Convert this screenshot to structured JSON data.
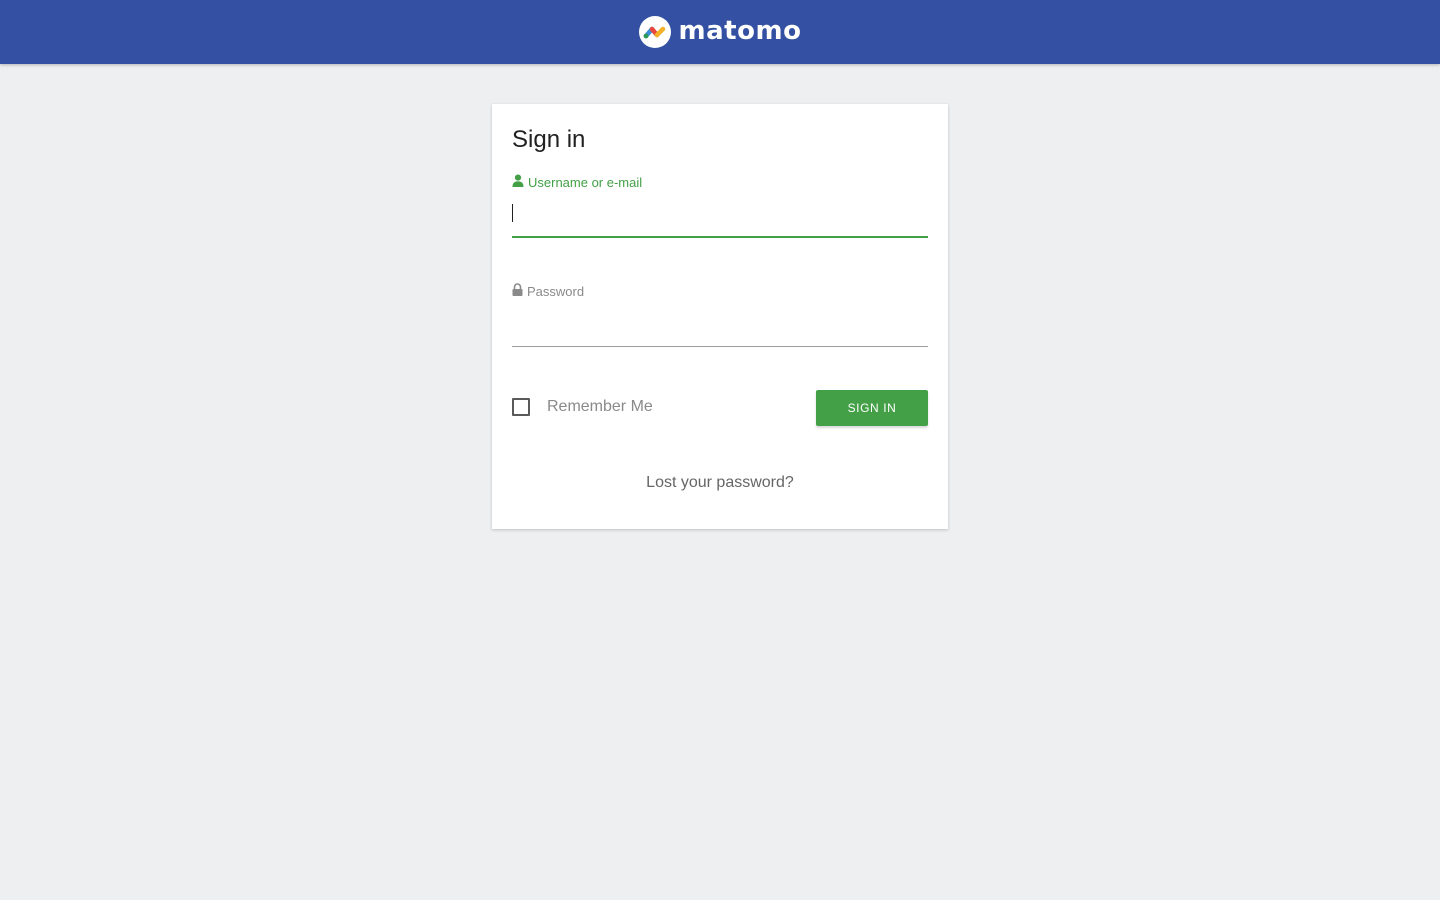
{
  "header": {
    "brand_name": "matomo",
    "background_color": "#3450a3"
  },
  "login": {
    "title": "Sign in",
    "username": {
      "label": "Username or e-mail",
      "value": "",
      "icon": "user-icon",
      "state": "focused"
    },
    "password": {
      "label": "Password",
      "value": "",
      "icon": "lock-icon"
    },
    "remember_me": {
      "label": "Remember Me",
      "checked": false
    },
    "submit_label": "SIGN IN",
    "lost_password_label": "Lost your password?"
  },
  "colors": {
    "accent": "#43a047",
    "page_background": "#eeeff1"
  }
}
